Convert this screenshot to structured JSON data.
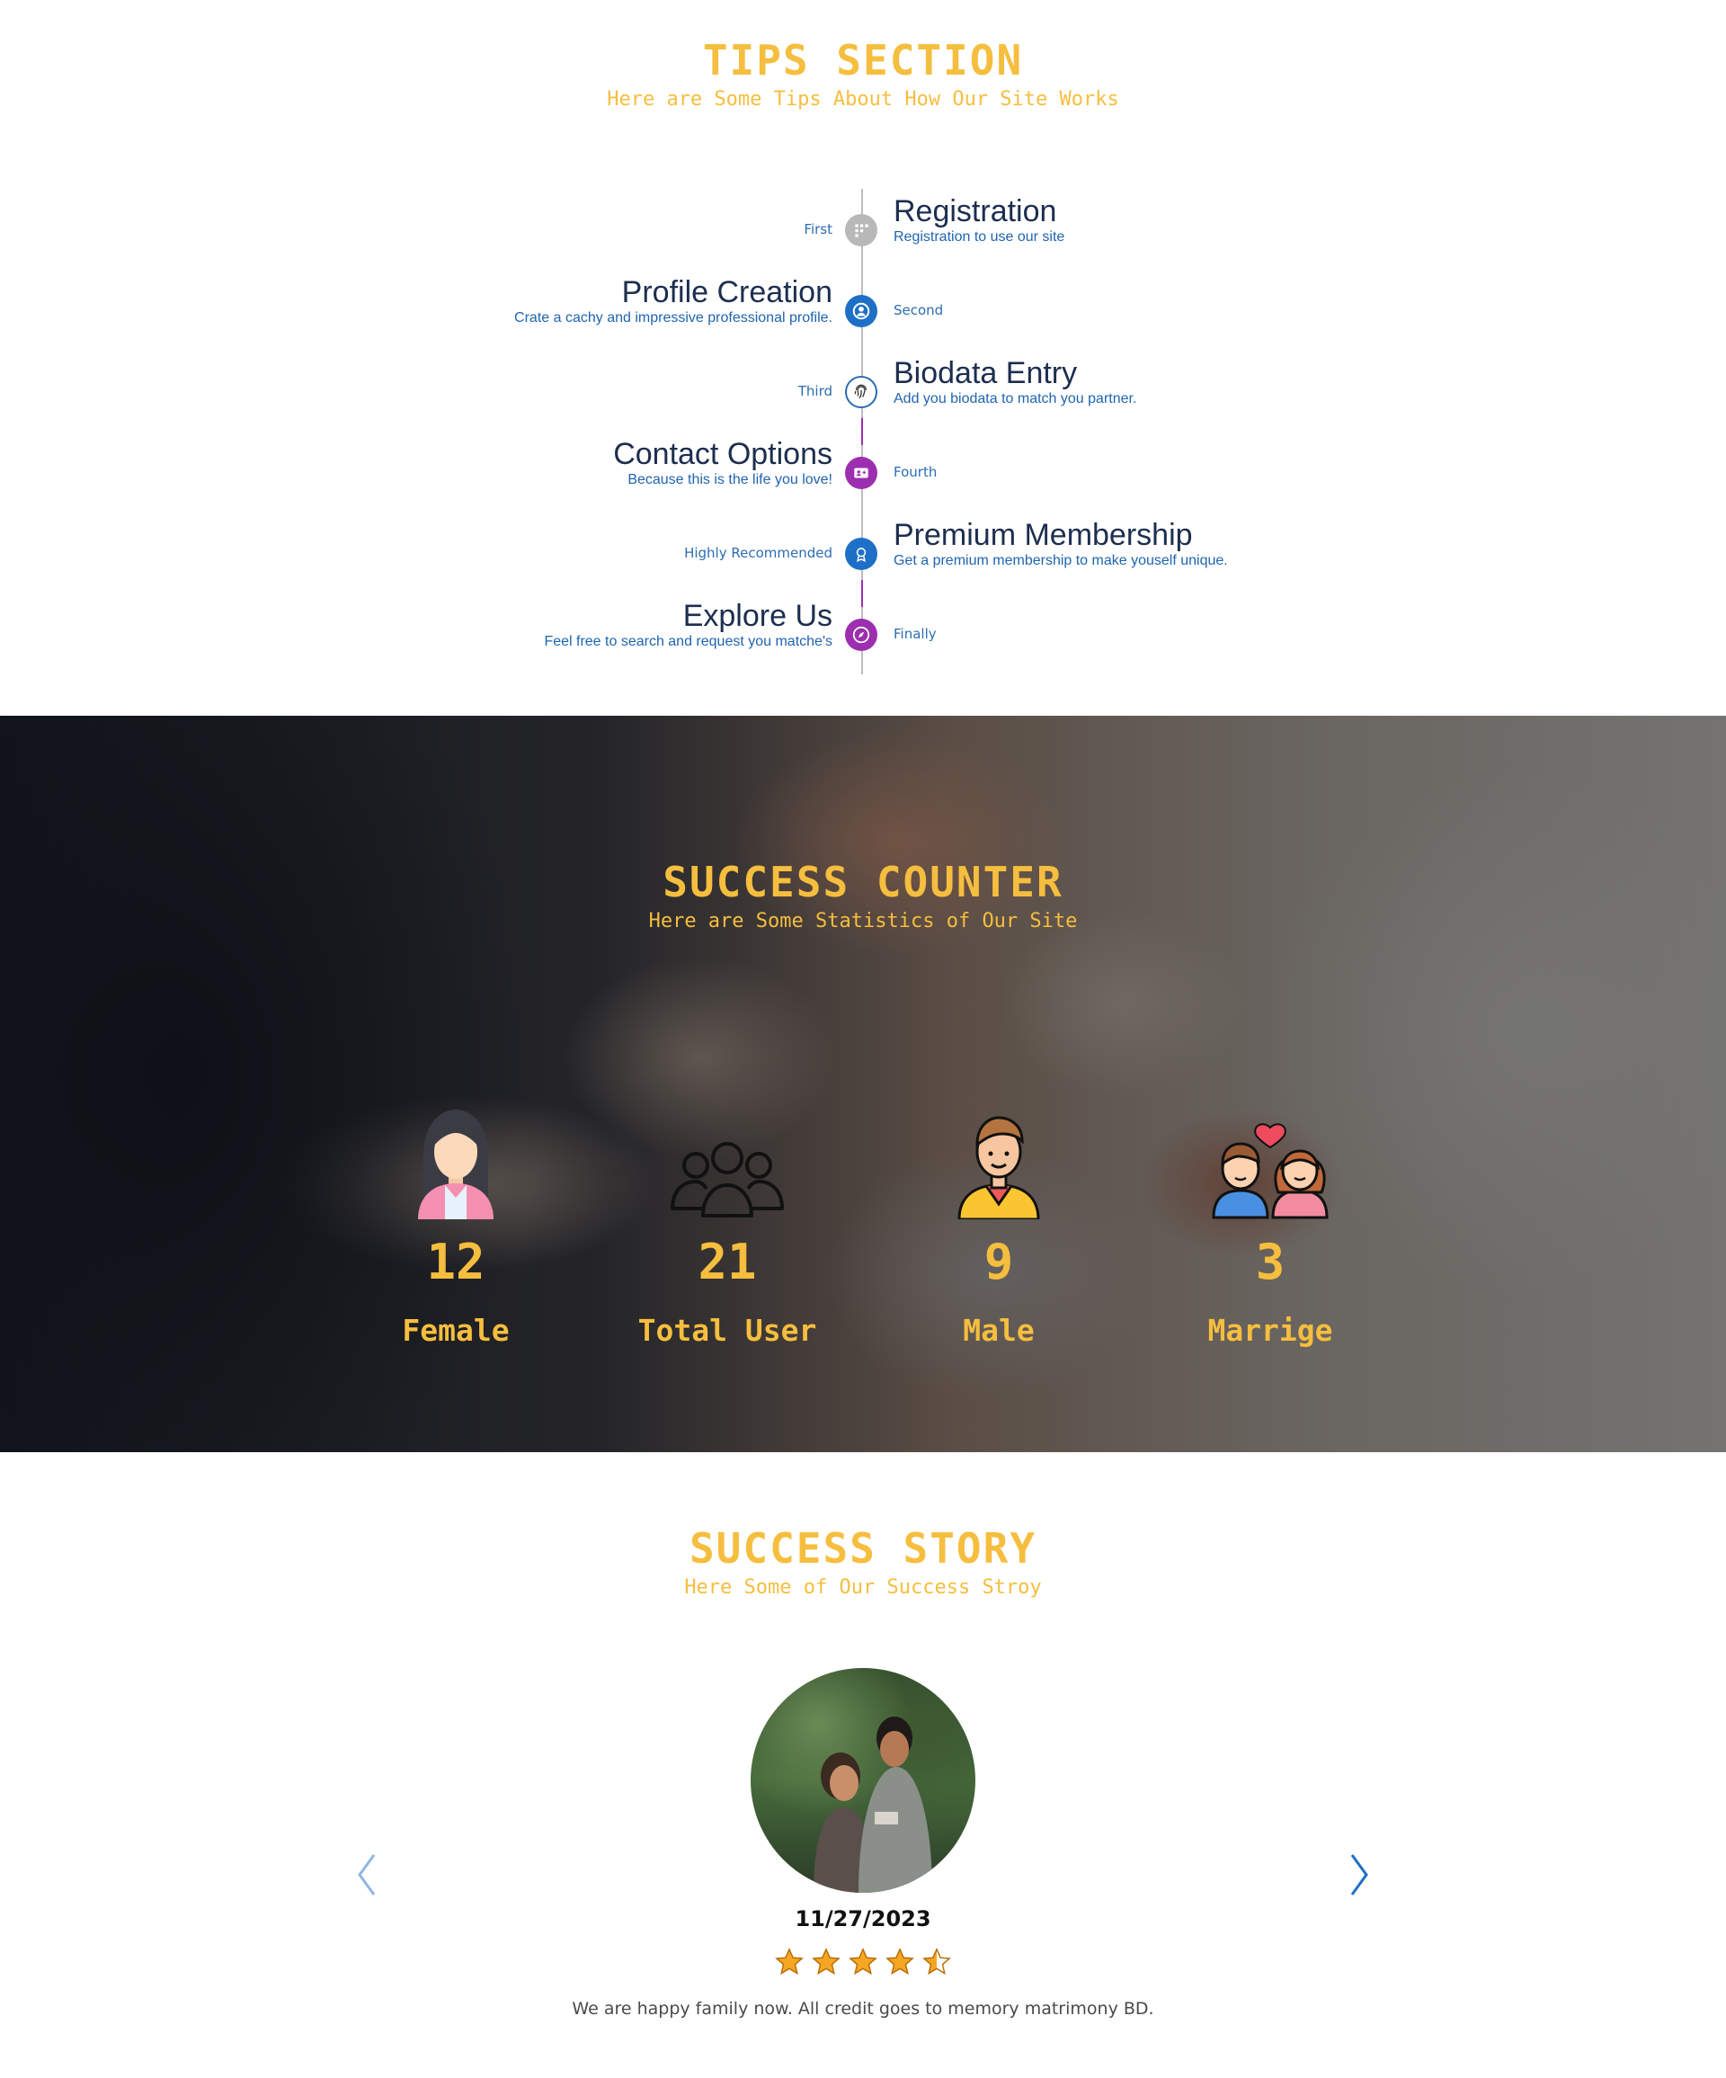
{
  "tips": {
    "title": "TIPS SECTION",
    "subtitle": "Here are Some Tips About How Our Site Works",
    "steps": [
      {
        "title": "Registration",
        "desc": "Registration to use our site",
        "order": "First",
        "icon": "grid-icon",
        "color": "#b8b8b8"
      },
      {
        "title": "Profile Creation",
        "desc": "Crate a cachy and impressive professional profile.",
        "order": "Second",
        "icon": "user-icon",
        "color": "#1e6fc6"
      },
      {
        "title": "Biodata Entry",
        "desc": "Add you biodata to match you partner.",
        "order": "Third",
        "icon": "fingerprint-icon",
        "color": "#ffffff"
      },
      {
        "title": "Contact Options",
        "desc": "Because this is the life you love!",
        "order": "Fourth",
        "icon": "contact-card-icon",
        "color": "#9c2fb0"
      },
      {
        "title": "Premium Membership",
        "desc": "Get a premium membership to make youself unique.",
        "order": "Highly Recommended",
        "icon": "award-icon",
        "color": "#1e6fc6"
      },
      {
        "title": "Explore Us",
        "desc": "Feel free to search and request you matche's",
        "order": "Finally",
        "icon": "compass-icon",
        "color": "#9c2fb0"
      }
    ]
  },
  "counter": {
    "title": "SUCCESS COUNTER",
    "subtitle": "Here are Some Statistics of Our Site",
    "stats": [
      {
        "value": "12",
        "label": "Female",
        "icon": "female-avatar-icon"
      },
      {
        "value": "21",
        "label": "Total User",
        "icon": "users-group-icon"
      },
      {
        "value": "9",
        "label": "Male",
        "icon": "male-avatar-icon"
      },
      {
        "value": "3",
        "label": "Marrige",
        "icon": "couple-icon"
      }
    ]
  },
  "story": {
    "title": "SUCCESS STORY",
    "subtitle": "Here Some of Our Success Stroy",
    "date": "11/27/2023",
    "rating": 4.5,
    "text": "We are happy family now. All credit goes to memory matrimony BD.",
    "accent": "#f6be3e",
    "arrow_color": "#1e6fc6"
  }
}
